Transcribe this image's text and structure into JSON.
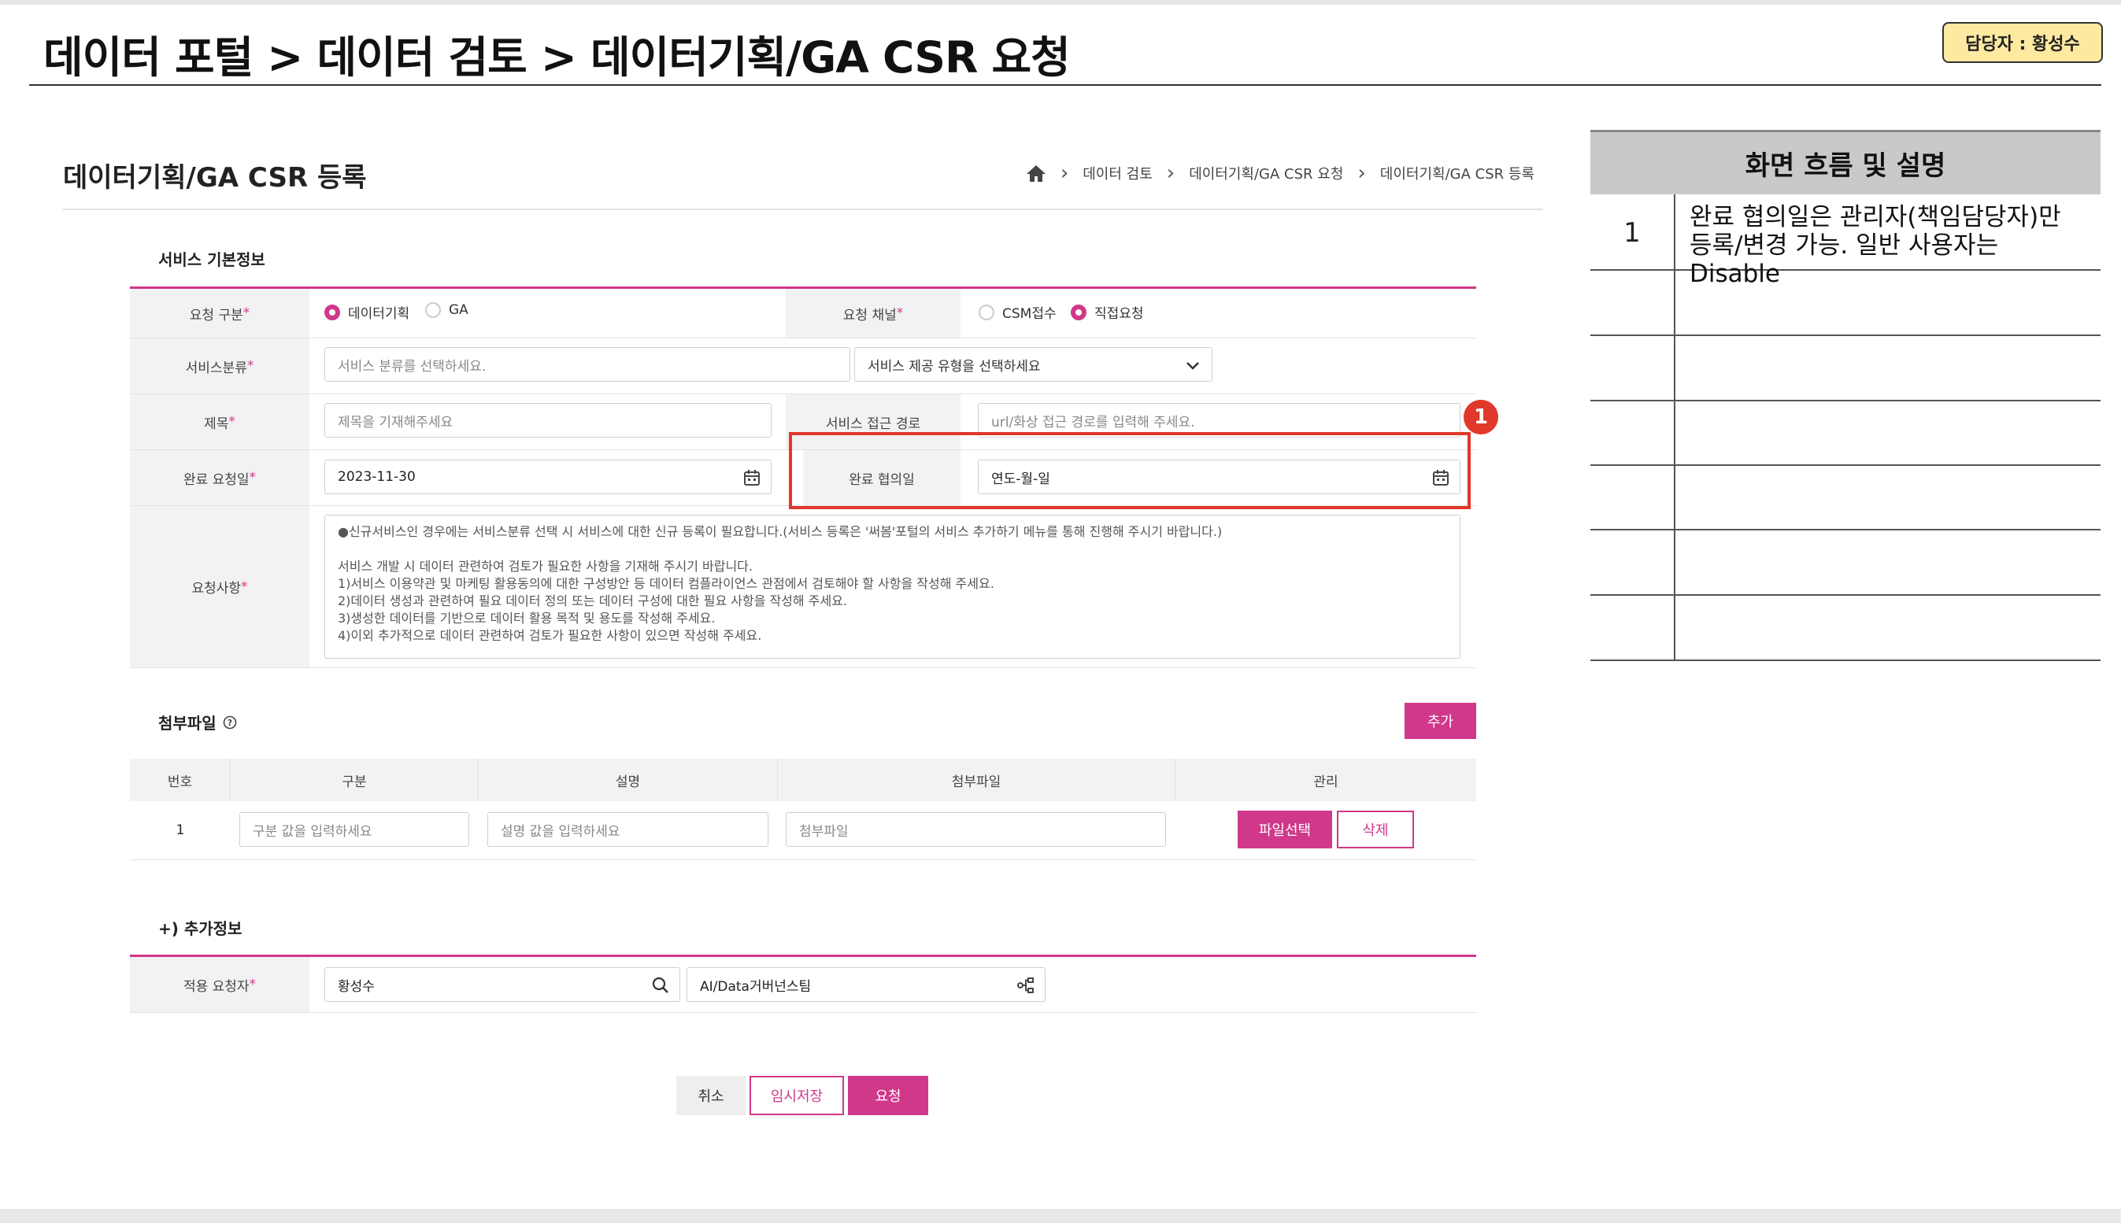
{
  "header": {
    "title": "데이터 포털 > 데이터 검토 > 데이터기획/GA CSR 요청",
    "owner_badge": "담당자 : 황성수"
  },
  "frame": {
    "title": "데이터기획/GA CSR 등록",
    "breadcrumb": [
      "데이터 검토",
      "데이터기획/GA CSR 요청",
      "데이터기획/GA CSR 등록"
    ]
  },
  "basic": {
    "section_title": "서비스 기본정보",
    "request_type_label": "요청 구분",
    "request_type_options": [
      "데이터기획",
      "GA"
    ],
    "channel_label": "요청 채널",
    "channel_options": [
      "CSM접수",
      "직접요청"
    ],
    "category_label": "서비스분류",
    "category_placeholder": "서비스 분류를 선택하세요.",
    "provide_type_placeholder": "서비스 제공 유형을 선택하세요",
    "subject_label": "제목",
    "subject_placeholder": "제목을 기재해주세요",
    "access_label": "서비스 접근 경로",
    "access_placeholder": "url/화상 접근 경로를 입력해 주세요.",
    "due_label": "완료 요청일",
    "due_value": "2023-11-30",
    "agreed_label": "완료 협의일",
    "agreed_placeholder": "연도-월-일",
    "detail_label": "요청사항",
    "detail_lines": [
      "●신규서비스인 경우에는 서비스분류 선택 시 서비스에 대한 신규 등록이 필요합니다.(서비스 등록은 '써봄'포털의 서비스 추가하기 메뉴를 통해 진행해 주시기 바랍니다.)",
      "",
      "서비스 개발 시 데이터 관련하여 검토가 필요한 사항을 기재해 주시기 바랍니다.",
      "  1)서비스 이용약관 및 마케팅 활용동의에 대한 구성방안 등 데이터 컴플라이언스 관점에서 검토해야 할 사항을 작성해 주세요.",
      "  2)데이터 생성과 관련하여 필요 데이터 정의 또는 데이터 구성에 대한 필요 사항을 작성해 주세요.",
      "  3)생성한 데이터를 기반으로 데이터 활용 목적 및 용도를 작성해 주세요.",
      "  4)이외 추가적으로 데이터 관련하여 검토가 필요한 사항이 있으면 작성해 주세요."
    ],
    "marker": "1"
  },
  "attach": {
    "section_title": "첨부파일",
    "add_button": "추가",
    "columns": [
      "번호",
      "구분",
      "설명",
      "첨부파일",
      "관리"
    ],
    "row": {
      "no": "1",
      "type_placeholder": "구분 값을 입력하세요",
      "desc_placeholder": "설명 값을 입력하세요",
      "file_placeholder": "첨부파일",
      "select_button": "파일선택",
      "delete_button": "삭제"
    }
  },
  "extra": {
    "section_title": "+) 추가정보",
    "requester_label": "적용 요청자",
    "requester_value": "황성수",
    "org_value": "AI/Data거버넌스팀"
  },
  "footer": {
    "cancel": "취소",
    "draft": "임시저장",
    "submit": "요청"
  },
  "side_panel": {
    "title": "화면 흐름 및 설명",
    "rows": [
      {
        "no": "1",
        "desc": "완료 협의일은 관리자(책임담당자)만 등록/변경 가능. 일반 사용자는 Disable"
      },
      {
        "no": "",
        "desc": ""
      },
      {
        "no": "",
        "desc": ""
      },
      {
        "no": "",
        "desc": ""
      },
      {
        "no": "",
        "desc": ""
      },
      {
        "no": "",
        "desc": ""
      }
    ]
  },
  "colors": {
    "accent": "#d0388a",
    "highlight": "#e0382b"
  }
}
